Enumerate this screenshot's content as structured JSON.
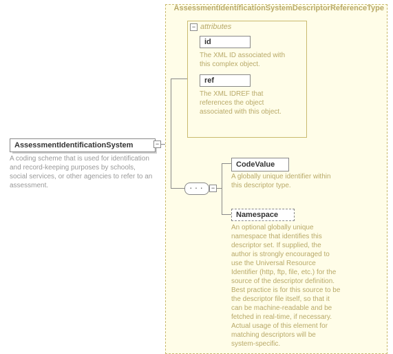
{
  "root": {
    "name": "AssessmentIdentificationSystem",
    "description": "A coding scheme that is used for identification and record-keeping purposes by schools, social services, or other agencies to refer to an assessment."
  },
  "type": {
    "name": "AssessmentIdentificationSystemDescriptorReferenceType"
  },
  "attributes": {
    "label": "attributes",
    "items": [
      {
        "name": "id",
        "description": "The XML ID associated with this complex object."
      },
      {
        "name": "ref",
        "description": "The XML IDREF that references the object associated with this object."
      }
    ]
  },
  "elements": [
    {
      "name": "CodeValue",
      "description": "A globally unique identifier within this descriptor type."
    },
    {
      "name": "Namespace",
      "description": "An optional globally unique namespace that identifies this descriptor set. If supplied, the author is strongly encouraged to use the Universal Resource Identifier (http, ftp, file, etc.) for the source of the descriptor definition. Best practice is for this source to be the descriptor file itself, so that it can be machine-readable and be fetched in real-time, if necessary. Actual usage of this element for matching descriptors will be system-specific."
    }
  ],
  "glyph": {
    "minus": "−"
  }
}
